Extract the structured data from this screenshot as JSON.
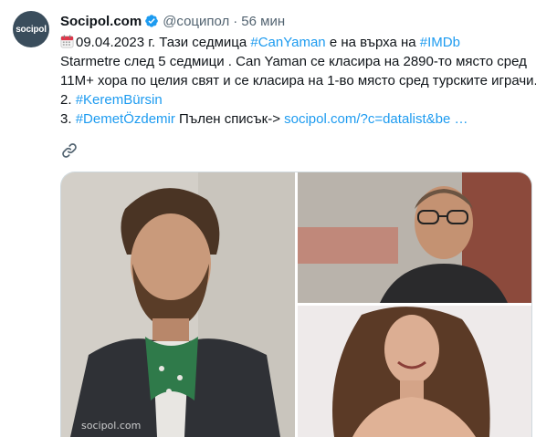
{
  "account": {
    "avatar_text": "socipol",
    "name": "Socipol.com",
    "handle": "@соципол",
    "separator": "·",
    "time": "56 мин"
  },
  "tweet": {
    "line1": {
      "date_text": "09.04.2023 г. Тази седмица ",
      "hashtag1": "#CanYaman",
      "mid_text": " е на върха на ",
      "hashtag2": "#IMDb"
    },
    "line2": "Starmetre след 5 седмици . Can Yaman се класира на 2890-то място сред",
    "line3": "11M+ хора по целия свят и се класира на 1-во място сред турските играчи.",
    "line4": {
      "prefix": "2. ",
      "hashtag": "#KeremBürsin"
    },
    "line5": {
      "prefix": "3. ",
      "hashtag": "#DemetÖzdemir",
      "text": " Пълен списък->  ",
      "link": "socipol.com/?c=datalist&be …"
    }
  },
  "media": {
    "watermark": "socipol.com"
  },
  "icons": {
    "calendar": "calendar-icon",
    "verified": "verified-badge-icon",
    "link": "link-icon"
  },
  "colors": {
    "link": "#1d9bf0",
    "text": "#0f1419",
    "muted": "#536471"
  }
}
